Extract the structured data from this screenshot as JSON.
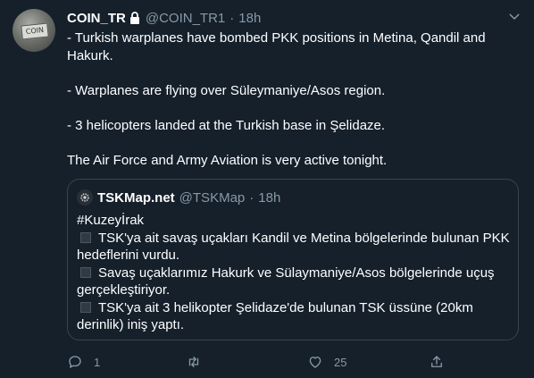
{
  "tweet": {
    "author": {
      "name": "COIN_TR",
      "handle": "@COIN_TR1",
      "separator": "·",
      "time": "18h",
      "avatar_text": "COIN"
    },
    "lines": [
      "- Turkish warplanes have bombed PKK positions in Metina, Qandil and Hakurk.",
      "- Warplanes are flying over Süleymaniye/Asos region.",
      "- 3 helicopters landed at the Turkish base in Şelidaze.",
      "The Air Force and Army Aviation is very active tonight."
    ]
  },
  "quoted_tweet": {
    "name": "TSKMap.net",
    "handle": "@TSKMap",
    "separator": "·",
    "time": "18h",
    "hashtag": "#Kuzeyİrak",
    "items": [
      "TSK'ya ait savaş uçakları Kandil ve Metina bölgelerinde bulunan PKK hedeflerini vurdu.",
      "Savaş uçaklarımız Hakurk ve Sülaymaniye/Asos bölgelerinde uçuş gerçekleştiriyor.",
      "TSK'ya ait 3 helikopter Şelidaze'de bulunan TSK üssüne (20km derinlik) iniş yaptı."
    ]
  },
  "actions": {
    "reply_count": "1",
    "retweet_count": "",
    "like_count": "25"
  },
  "colors": {
    "background": "#15202b",
    "text": "#ffffff",
    "secondary": "#8899a6",
    "border": "#38444d"
  },
  "icons": [
    "lock-icon",
    "chevron-down-icon",
    "reply-icon",
    "retweet-icon",
    "like-icon",
    "share-icon"
  ]
}
